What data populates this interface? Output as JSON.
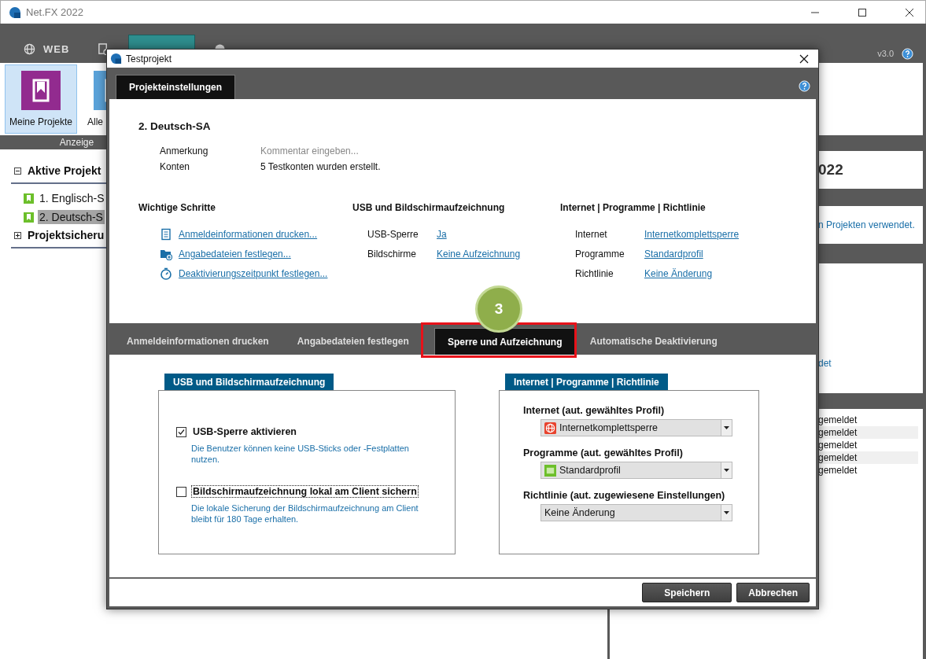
{
  "window": {
    "title": "Net.FX 2022"
  },
  "main_tabs": [
    {
      "label": "WEB",
      "kind": "globe",
      "selected": false
    },
    {
      "kind": "log",
      "selected": false
    },
    {
      "kind": "test",
      "selected": true
    },
    {
      "kind": "history",
      "selected": false
    }
  ],
  "version": "v3.0",
  "ribbon": {
    "items": [
      {
        "label": "Meine Projekte",
        "selected": true,
        "color": "#922b8f"
      },
      {
        "label": "Alle",
        "selected": false,
        "color": "#5ba3da"
      }
    ],
    "group_label": "Anzeige"
  },
  "tree": [
    {
      "label": "Aktive Projekt",
      "expanded": true,
      "children": [
        {
          "label": "1. Englisch-S",
          "selected": false
        },
        {
          "label": "2. Deutsch-S",
          "selected": true
        }
      ]
    },
    {
      "label": "Projektsicheru",
      "expanded": false
    }
  ],
  "side_panels": {
    "heading": "022",
    "note": "n Projekten verwendet.",
    "link": "det",
    "list": [
      "gemeldet",
      "gemeldet",
      "gemeldet",
      "gemeldet",
      "gemeldet"
    ]
  },
  "dialog": {
    "title": "Testprojekt",
    "tab": "Projekteinstellungen",
    "project": "2. Deutsch-SA",
    "fields": [
      {
        "label": "Anmerkung",
        "placeholder": "Kommentar eingeben..."
      },
      {
        "label": "Konten",
        "value": "5 Testkonten wurden erstellt."
      }
    ],
    "steps": {
      "heading": "Wichtige Schritte",
      "links": [
        {
          "kind": "print",
          "text": "Anmeldeinformationen drucken..."
        },
        {
          "kind": "folder",
          "text": "Angabedateien festlegen..."
        },
        {
          "kind": "timer",
          "text": "Deaktivierungszeitpunkt festlegen..."
        }
      ]
    },
    "usb_summary": {
      "heading": "USB und Bildschirmaufzeichnung",
      "rows": [
        {
          "label": "USB-Sperre",
          "value": "Ja"
        },
        {
          "label": "Bildschirme",
          "value": "Keine Aufzeichnung"
        }
      ]
    },
    "net_summary": {
      "heading": "Internet | Programme | Richtlinie",
      "rows": [
        {
          "label": "Internet",
          "value": "Internetkomplettsperre"
        },
        {
          "label": "Programme",
          "value": "Standardprofil"
        },
        {
          "label": "Richtlinie",
          "value": "Keine Änderung"
        }
      ]
    },
    "tabs": [
      {
        "label": "Anmeldeinformationen drucken",
        "selected": false
      },
      {
        "label": "Angabedateien festlegen",
        "selected": false
      },
      {
        "label": "Sperre und Aufzeichnung",
        "selected": true
      },
      {
        "label": "Automatische Deaktivierung",
        "selected": false
      }
    ],
    "step_badge": "3",
    "usb_group": {
      "title": "USB und Bildschirmaufzeichnung",
      "options": [
        {
          "label": "USB-Sperre aktivieren",
          "checked": true,
          "focused": false,
          "description": "Die Benutzer können keine USB-Sticks oder -Festplatten nutzen."
        },
        {
          "label": "Bildschirmaufzeichnung lokal am Client sichern",
          "checked": false,
          "focused": true,
          "description": "Die lokale Sicherung der Bildschirmaufzeichnung am Client bleibt für 180 Tage erhalten."
        }
      ]
    },
    "net_group": {
      "title": "Internet | Programme | Richtlinie",
      "selects": [
        {
          "label": "Internet (aut. gewähltes Profil)",
          "value": "Internetkomplettsperre",
          "kind": "globe"
        },
        {
          "label": "Programme (aut. gewähltes Profil)",
          "value": "Standardprofil",
          "kind": "profile"
        },
        {
          "label": "Richtlinie (aut. zugewiesene Einstellungen)",
          "value": "Keine Änderung",
          "kind": "plain"
        }
      ]
    },
    "buttons": [
      "Speichern",
      "Abbrechen"
    ]
  }
}
